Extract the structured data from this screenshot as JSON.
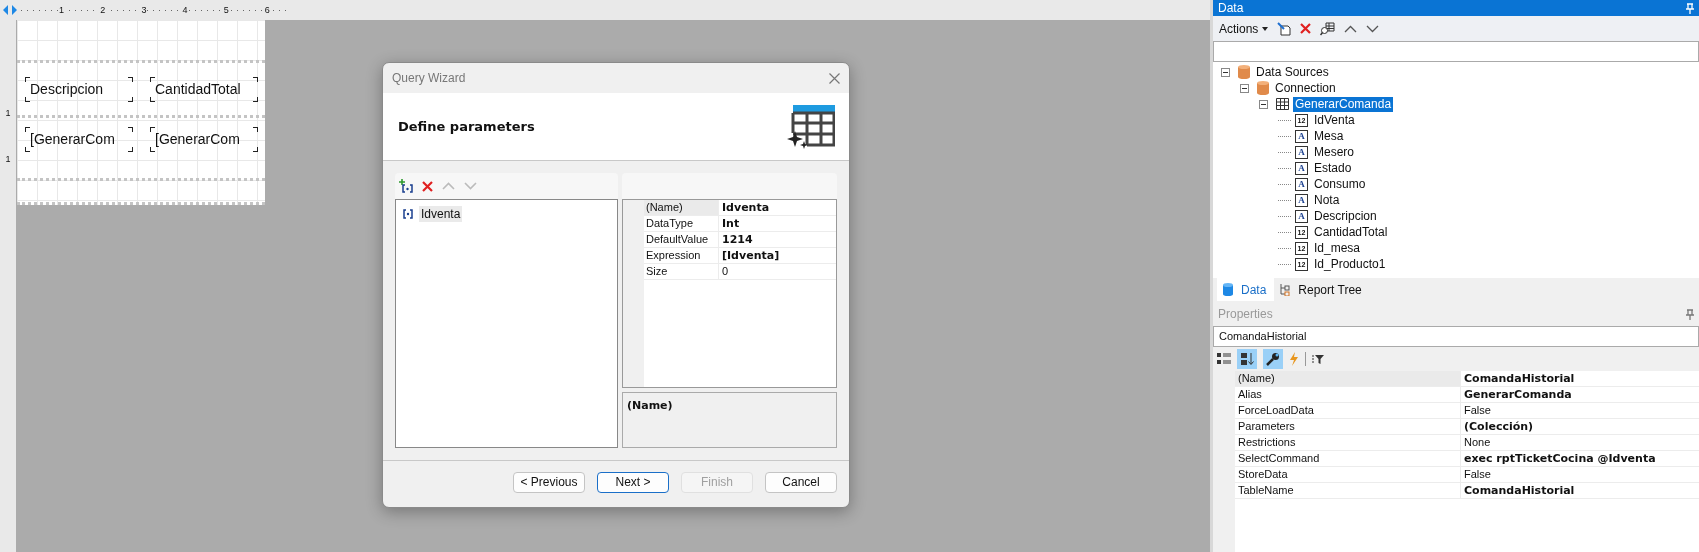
{
  "designer": {
    "ruler_marks": [
      "1",
      "2",
      "3",
      "4",
      "5",
      "6"
    ],
    "vertical_ruler_marks": [
      "1",
      "1"
    ],
    "report_rows": [
      [
        "Descripcion",
        "CantidadTotal"
      ],
      [
        "[GenerarCom",
        "[GenerarCom"
      ]
    ]
  },
  "dialog": {
    "title": "Query Wizard",
    "heading": "Define parameters",
    "parameters": [
      {
        "label": "Idventa",
        "selected": true
      }
    ],
    "property_grid": [
      {
        "name": "(Name)",
        "value": "Idventa",
        "bold": true,
        "selected": true
      },
      {
        "name": "DataType",
        "value": "Int",
        "bold": true,
        "selected": false
      },
      {
        "name": "DefaultValue",
        "value": "1214",
        "bold": true,
        "selected": false
      },
      {
        "name": "Expression",
        "value": "[Idventa]",
        "bold": true,
        "selected": false
      },
      {
        "name": "Size",
        "value": "0",
        "bold": false,
        "selected": false
      }
    ],
    "description_title": "(Name)",
    "buttons": [
      {
        "label": "< Previous",
        "default": false,
        "disabled": false
      },
      {
        "label": "Next >",
        "default": true,
        "disabled": false
      },
      {
        "label": "Finish",
        "default": false,
        "disabled": true
      },
      {
        "label": "Cancel",
        "default": false,
        "disabled": false
      }
    ]
  },
  "data_panel": {
    "title": "Data",
    "actions_label": "Actions",
    "tree": [
      {
        "label": "Data Sources",
        "kind": "datasource",
        "expanded": true,
        "selected": false,
        "children": [
          {
            "label": "Connection",
            "kind": "datasource",
            "expanded": true,
            "selected": false,
            "children": [
              {
                "label": "GenerarComanda",
                "kind": "table",
                "expanded": true,
                "selected": true,
                "children": [
                  {
                    "label": "IdVenta",
                    "kind": "number",
                    "icon_text": "12",
                    "selected": false
                  },
                  {
                    "label": "Mesa",
                    "kind": "text",
                    "icon_text": "A",
                    "selected": false
                  },
                  {
                    "label": "Mesero",
                    "kind": "text",
                    "icon_text": "A",
                    "selected": false
                  },
                  {
                    "label": "Estado",
                    "kind": "text",
                    "icon_text": "A",
                    "selected": false
                  },
                  {
                    "label": "Consumo",
                    "kind": "text",
                    "icon_text": "A",
                    "selected": false
                  },
                  {
                    "label": "Nota",
                    "kind": "text",
                    "icon_text": "A",
                    "selected": false
                  },
                  {
                    "label": "Descripcion",
                    "kind": "text",
                    "icon_text": "A",
                    "selected": false
                  },
                  {
                    "label": "CantidadTotal",
                    "kind": "number",
                    "icon_text": "12",
                    "selected": false
                  },
                  {
                    "label": "Id_mesa",
                    "kind": "number",
                    "icon_text": "12",
                    "selected": false
                  },
                  {
                    "label": "Id_Producto1",
                    "kind": "number",
                    "icon_text": "12",
                    "selected": false
                  }
                ]
              }
            ]
          }
        ]
      }
    ],
    "tabs": [
      {
        "label": "Data",
        "selected": true
      },
      {
        "label": "Report Tree",
        "selected": false
      }
    ]
  },
  "properties_panel": {
    "title": "Properties",
    "object": "ComandaHistorial",
    "rows": [
      {
        "name": "(Name)",
        "value": "ComandaHistorial",
        "bold": true,
        "selected": true
      },
      {
        "name": "Alias",
        "value": "GenerarComanda",
        "bold": true,
        "selected": false
      },
      {
        "name": "ForceLoadData",
        "value": "False",
        "bold": false,
        "selected": false
      },
      {
        "name": "Parameters",
        "value": "(Colección)",
        "bold": true,
        "selected": false
      },
      {
        "name": "Restrictions",
        "value": "None",
        "bold": false,
        "selected": false
      },
      {
        "name": "SelectCommand",
        "value": "exec rptTicketCocina @Idventa",
        "bold": true,
        "selected": false
      },
      {
        "name": "StoreData",
        "value": "False",
        "bold": false,
        "selected": false
      },
      {
        "name": "TableName",
        "value": "ComandaHistorial",
        "bold": true,
        "selected": false
      }
    ]
  }
}
